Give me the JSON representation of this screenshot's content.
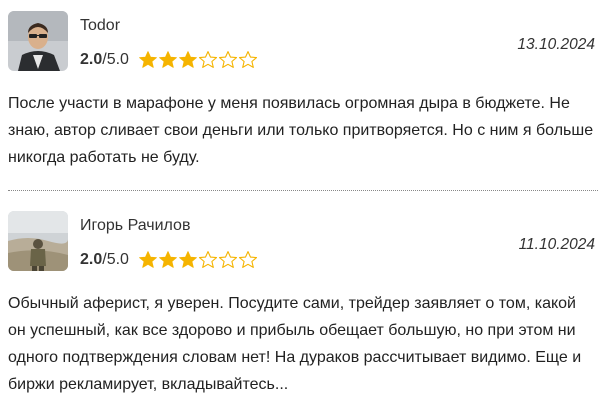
{
  "reviews": [
    {
      "author": "Todor",
      "score": "2.0",
      "max": "/5.0",
      "stars_filled": 3,
      "stars_total": 6,
      "date": "13.10.2024",
      "text": "После участи в марафоне у меня появилась огромная дыра в бюджете. Не знаю, автор сливает свои деньги или только притворяется. Но с ним я больше никогда работать не буду."
    },
    {
      "author": "Игорь Рачилов",
      "score": "2.0",
      "max": "/5.0",
      "stars_filled": 3,
      "stars_total": 6,
      "date": "11.10.2024",
      "text": "Обычный аферист, я уверен. Посудите сами, трейдер заявляет о том, какой он успешный, как все здорово и прибыль обещает большую, но при этом ни одного подтверждения словам нет! На дураков рассчитывает видимо. Еще и биржи рекламирует, вкладывайтесь..."
    }
  ],
  "colors": {
    "star": "#f5b400",
    "star_outline": "#f5b400",
    "divider": "#888888"
  },
  "icons": {
    "star_filled": "star-filled-icon",
    "star_empty": "star-outline-icon"
  }
}
